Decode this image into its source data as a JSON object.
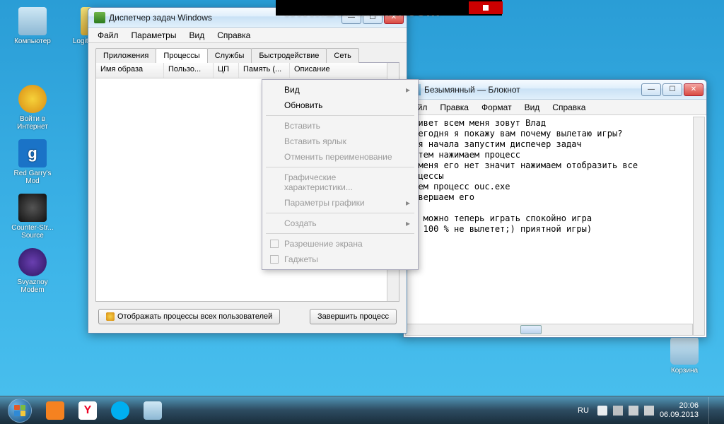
{
  "watermark": "www.Bandicam.com",
  "desktop": {
    "icons": [
      {
        "label": "Компьютер"
      },
      {
        "label": "Logit...\nHam..."
      },
      {
        "label": "Войти в Интернет"
      },
      {
        "label": "Red Garry's Mod"
      },
      {
        "label": "Counter-Str... Source"
      },
      {
        "label": "Svyaznoy Modem"
      }
    ],
    "recycle": "Корзина"
  },
  "taskmgr": {
    "title": "Диспетчер задач Windows",
    "menu": [
      "Файл",
      "Параметры",
      "Вид",
      "Справка"
    ],
    "tabs": [
      "Приложения",
      "Процессы",
      "Службы",
      "Быстродействие",
      "Сеть"
    ],
    "active_tab": 1,
    "columns": [
      "Имя образа",
      "Пользо...",
      "ЦП",
      "Память (...",
      "Описание"
    ],
    "show_all_btn": "Отображать процессы всех пользователей",
    "end_btn": "Завершить процесс"
  },
  "ctx": {
    "items": [
      {
        "label": "Вид",
        "enabled": true,
        "sub": true
      },
      {
        "label": "Обновить",
        "enabled": true
      },
      {
        "sep": true
      },
      {
        "label": "Вставить",
        "enabled": false
      },
      {
        "label": "Вставить ярлык",
        "enabled": false
      },
      {
        "label": "Отменить переименование",
        "enabled": false
      },
      {
        "sep": true
      },
      {
        "label": "Графические характеристики...",
        "enabled": false
      },
      {
        "label": "Параметры графики",
        "enabled": false,
        "sub": true
      },
      {
        "sep": true
      },
      {
        "label": "Создать",
        "enabled": false,
        "sub": true
      },
      {
        "sep": true
      },
      {
        "label": "Разрешение экрана",
        "enabled": false,
        "chk": true
      },
      {
        "label": "Гаджеты",
        "enabled": false,
        "chk": true
      }
    ]
  },
  "notepad": {
    "title": "Безымянный — Блокнот",
    "menu": [
      "айл",
      "Правка",
      "Формат",
      "Вид",
      "Справка"
    ],
    "text": "привет всем меня зовут Влад\n сегодня я покажу вам почему вылетаю игры?\nдля начала запустим диспечер задач\nзатем нажимаем процесс\nу меня его нет значит нажимаем отобразить все\nроцессы\nищем процесс ouc.exe\nзавершаем его\n\nсе можно теперь играть спокойно игра\nра 100 % не вылетет;) приятной игры)"
  },
  "tray": {
    "lang": "RU",
    "time": "20:06",
    "date": "06.09.2013"
  }
}
